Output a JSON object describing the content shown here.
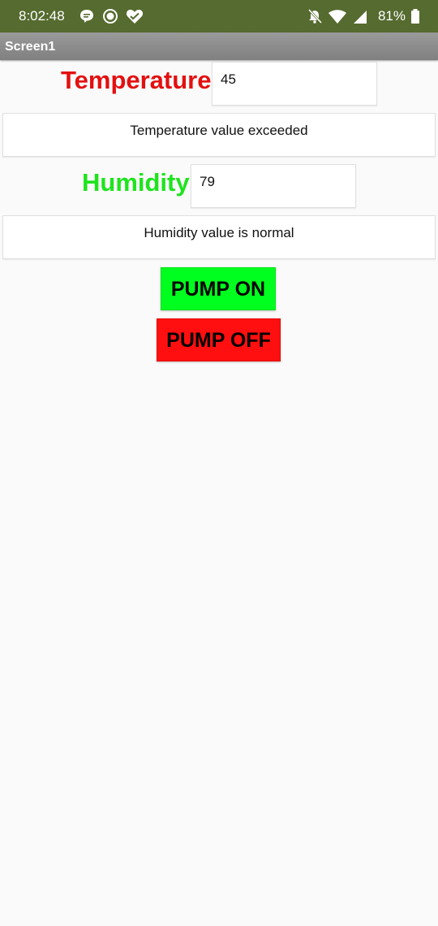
{
  "status_bar": {
    "time": "8:02:48",
    "battery_percent": "81%",
    "icons": [
      "chat-icon",
      "record-icon",
      "heart-icon",
      "mute-icon",
      "wifi-icon",
      "signal-icon",
      "battery-icon"
    ]
  },
  "title_bar": {
    "title": "Screen1"
  },
  "temperature": {
    "label": "Temperature",
    "value": "45",
    "message": "Temperature value exceeded",
    "color": "#e31010"
  },
  "humidity": {
    "label": "Humidity",
    "value": "79",
    "message": "Humidity value is normal",
    "color": "#1ee41e"
  },
  "buttons": {
    "pump_on_label": "PUMP ON",
    "pump_on_color": "#00ff1e",
    "pump_off_label": "PUMP OFF",
    "pump_off_color": "#ff0f0f"
  },
  "colors": {
    "status_bar": "#556b2f",
    "title_bar": "#8c8c8c",
    "background": "#fafafa"
  }
}
